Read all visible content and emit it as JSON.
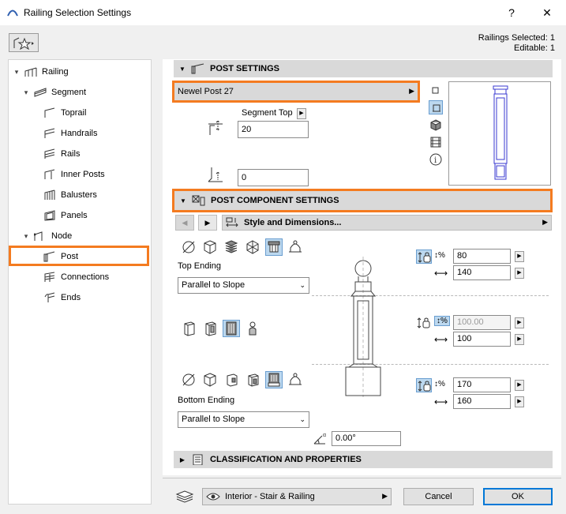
{
  "window": {
    "title": "Railing Selection Settings",
    "help_label": "?",
    "close_label": "✕"
  },
  "counters": {
    "selected": "Railings Selected: 1",
    "editable": "Editable: 1"
  },
  "tree": {
    "items": [
      {
        "label": "Railing",
        "icon": "railing-icon"
      },
      {
        "label": "Segment",
        "icon": "segment-icon"
      },
      {
        "label": "Toprail",
        "icon": "toprail-icon"
      },
      {
        "label": "Handrails",
        "icon": "handrail-icon"
      },
      {
        "label": "Rails",
        "icon": "rail-icon"
      },
      {
        "label": "Inner Posts",
        "icon": "inner-post-icon"
      },
      {
        "label": "Balusters",
        "icon": "baluster-icon"
      },
      {
        "label": "Panels",
        "icon": "panel-icon"
      },
      {
        "label": "Node",
        "icon": "node-icon"
      },
      {
        "label": "Post",
        "icon": "post-icon"
      },
      {
        "label": "Connections",
        "icon": "connection-icon"
      },
      {
        "label": "Ends",
        "icon": "end-icon"
      }
    ]
  },
  "post_settings": {
    "header": "POST SETTINGS",
    "selected_post": "Newel Post 27",
    "segment_top_label": "Segment Top",
    "top_offset": "20",
    "bottom_offset": "0"
  },
  "component_settings": {
    "header": "POST COMPONENT SETTINGS",
    "tab_label": "Style and Dimensions...",
    "top_ending_label": "Top Ending",
    "top_ending_value": "Parallel to Slope",
    "bottom_ending_label": "Bottom Ending",
    "bottom_ending_value": "Parallel to Slope",
    "top_height": "80",
    "top_width": "140",
    "mid_height": "100.00",
    "mid_width": "100",
    "bottom_height": "170",
    "bottom_width": "160",
    "angle": "0.00°",
    "percent_symbol": "%"
  },
  "classification": {
    "header": "CLASSIFICATION AND PROPERTIES"
  },
  "footer": {
    "layer": "Interior - Stair & Railing",
    "cancel_label": "Cancel",
    "ok_label": "OK"
  },
  "colors": {
    "highlight": "#f47b20",
    "selected_icon": "#bcd8ef",
    "accent": "#0078d7"
  }
}
